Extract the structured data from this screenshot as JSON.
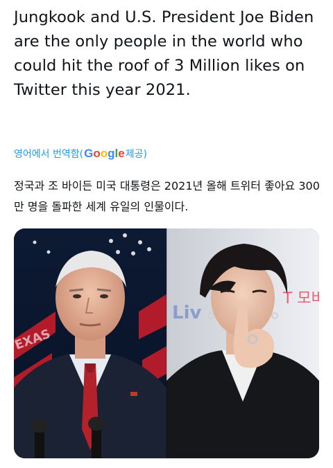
{
  "tweet": {
    "text": "Jungkook and U.S. President Joe Biden are the only people in the world who could hit the roof of 3 Million likes on Twitter this year 2021.",
    "translate_prefix": "영어에서 번역함(",
    "google_letters": [
      "G",
      "o",
      "o",
      "g",
      "l",
      "e"
    ],
    "translate_suffix": " 제공)",
    "translated_text": "정국과 조 바이든 미국 대통령은 2021년 올해 트위터 좋아요 300만 명을 돌파한 세계 유일의 인물이다.",
    "photo_left_sign": "EXAS",
    "photo_right_sign_a": "Liv",
    "photo_right_sign_b": "T 모바"
  },
  "colors": {
    "text": "#0f1419",
    "link": "#1d9bf0"
  }
}
